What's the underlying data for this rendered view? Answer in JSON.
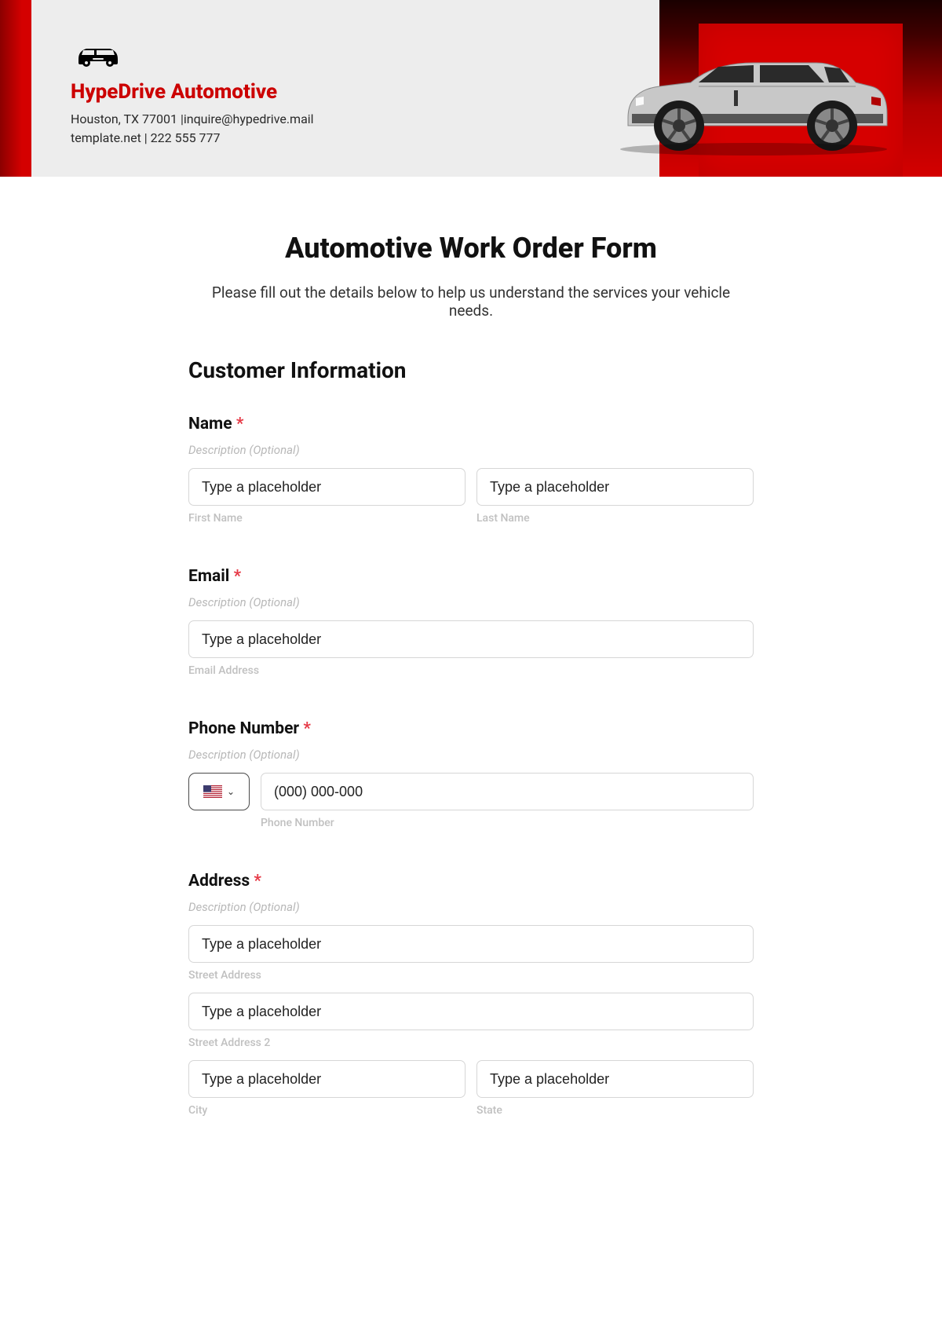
{
  "brand": {
    "name": "HypeDrive Automotive",
    "address_line": "Houston, TX 77001 |inquire@hypedrive.mail",
    "contact_line": "template.net | 222 555 777"
  },
  "page": {
    "title": "Automotive Work Order Form",
    "subtitle": "Please fill out the details below to help us understand the services your vehicle needs."
  },
  "section": {
    "customer_info": "Customer Information"
  },
  "fields": {
    "name": {
      "label": "Name",
      "desc": "Description (Optional)",
      "first_placeholder": "Type a placeholder",
      "first_sublabel": "First Name",
      "last_placeholder": "Type a placeholder",
      "last_sublabel": "Last Name"
    },
    "email": {
      "label": "Email",
      "desc": "Description (Optional)",
      "placeholder": "Type a placeholder",
      "sublabel": "Email Address"
    },
    "phone": {
      "label": "Phone Number",
      "desc": "Description (Optional)",
      "placeholder": "(000) 000-000",
      "sublabel": "Phone Number"
    },
    "address": {
      "label": "Address",
      "desc": "Description (Optional)",
      "street_placeholder": "Type a placeholder",
      "street_sublabel": "Street Address",
      "street2_placeholder": "Type a placeholder",
      "street2_sublabel": "Street Address 2",
      "city_placeholder": "Type a placeholder",
      "city_sublabel": "City",
      "state_placeholder": "Type a placeholder",
      "state_sublabel": "State"
    }
  },
  "required_mark": "*"
}
